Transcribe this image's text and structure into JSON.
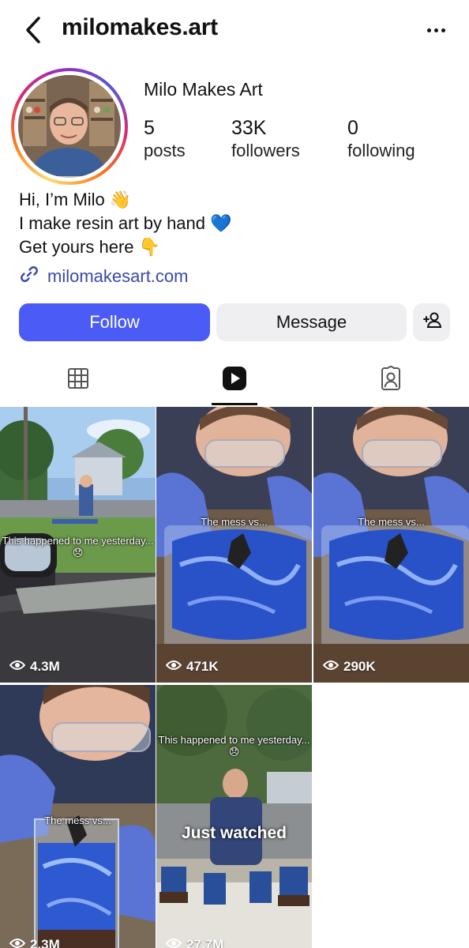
{
  "header": {
    "handle": "milomakes.art"
  },
  "profile": {
    "display_name": "Milo Makes Art",
    "stats": [
      {
        "value": "5",
        "label": "posts"
      },
      {
        "value": "33K",
        "label": "followers"
      },
      {
        "value": "0",
        "label": "following"
      }
    ],
    "bio_lines": [
      "Hi, I’m Milo 👋",
      "I make resin art by hand 💙",
      "Get yours here 👇"
    ],
    "link": "milomakesart.com"
  },
  "actions": {
    "follow_label": "Follow",
    "message_label": "Message"
  },
  "tabs": {
    "items": [
      "grid-icon",
      "reels-icon",
      "tagged-icon"
    ],
    "active_index": 1
  },
  "reels": [
    {
      "views": "4.3M",
      "caption": "This happened to me yesterday...😞"
    },
    {
      "views": "471K",
      "caption": "The mess vs..."
    },
    {
      "views": "290K",
      "caption": "The mess vs..."
    },
    {
      "views": "2.3M",
      "caption": "The mess vs..."
    },
    {
      "views": "27.7M",
      "caption": "This happened to me yesterday...😞",
      "caption_big": "Just watched"
    }
  ],
  "colors": {
    "follow_button": "#4a5cf5",
    "link": "#3949ab",
    "secondary_button": "#efeff2"
  }
}
